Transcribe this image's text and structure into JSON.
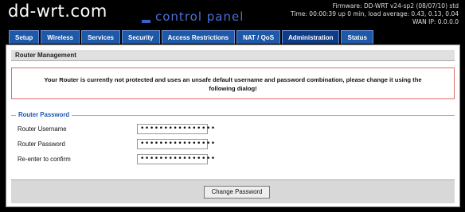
{
  "header": {
    "logo_main": "dd-wrt.com",
    "logo_sub": "control panel",
    "firmware": "Firmware: DD-WRT v24-sp2 (08/07/10) std",
    "time": "Time: 00:00:39 up 0 min, load average: 0.43, 0.13, 0.04",
    "wan_ip": "WAN IP: 0.0.0.0"
  },
  "tabs": [
    {
      "label": "Setup"
    },
    {
      "label": "Wireless"
    },
    {
      "label": "Services"
    },
    {
      "label": "Security"
    },
    {
      "label": "Access Restrictions"
    },
    {
      "label": "NAT / QoS"
    },
    {
      "label": "Administration"
    },
    {
      "label": "Status"
    }
  ],
  "main": {
    "section_title": "Router Management",
    "warning_line1": "Your Router is currently not protected and uses an unsafe default username and password combination, please change it using the",
    "warning_line2": "following dialog!",
    "fieldset_legend": "Router Password",
    "fields": [
      {
        "label": "Router Username",
        "value": "••••••••••••••••"
      },
      {
        "label": "Router Password",
        "value": "••••••••••••••••"
      },
      {
        "label": "Re-enter to confirm",
        "value": "••••••••••••••••"
      }
    ],
    "button_label": "Change Password"
  }
}
